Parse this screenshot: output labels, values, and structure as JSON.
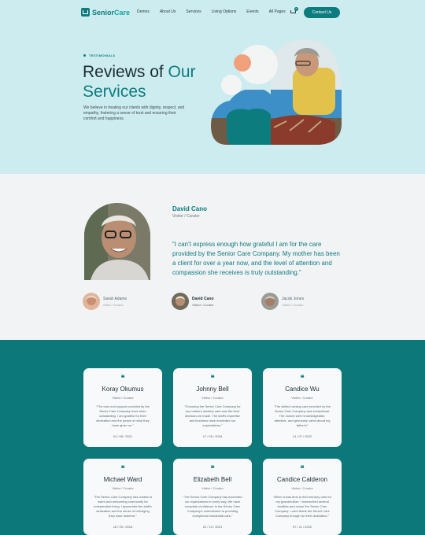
{
  "brand": {
    "name_part1": "Senior",
    "name_part2": "Care"
  },
  "nav": {
    "items": [
      "Demos",
      "About Us",
      "Services",
      "Living Options",
      "Events",
      "All Pages"
    ],
    "cart_count": "0",
    "contact_label": "Contact Us"
  },
  "hero": {
    "eyebrow": "TESTIMONIALS",
    "title_line1": "Reviews of ",
    "title_accent1": "Our",
    "title_accent2": "Services",
    "description": "We believe in treating our clients with dignity, respect, and empathy, fostering a sense of trust and ensuring their comfort and happiness."
  },
  "featured": {
    "name": "David Cano",
    "role": "Visitor / Curator",
    "quote": "“I can’t express enough how grateful I am for the care provided by the Senior Care Company. My mother has been a client for over a year now, and the level of attention and compassion she receives is truly outstanding.”",
    "people": [
      {
        "name": "Sarah Adams",
        "role": "Artist / Curator"
      },
      {
        "name": "David Cano",
        "role": "Visitor / Curator"
      },
      {
        "name": "Jacob Jones",
        "role": "Visitor / Curator"
      }
    ]
  },
  "cards": [
    {
      "name": "Koray Okumus",
      "role": "Visitor / Curator",
      "text": "“The care and support provided by the Senior Care Company have been outstanding. I am grateful for their dedication and the peace of mind they have given us.”",
      "date": "04 / 08 / 2021"
    },
    {
      "name": "Johnny Bell",
      "role": "Visitor / Curator",
      "text": "“Choosing the Senior Care Company for my mothers ministry care was the best decision we made. The staff's expertise and kindness have exceeded our expectations.”",
      "date": "17 / 05 / 2018"
    },
    {
      "name": "Candice Wu",
      "role": "Visitor / Curator",
      "text": "“The skilled nursing care provided by the Senior Care Company was exceptional. The nurses were knowledgeable, attentive, and genuinely cared about my father's”",
      "date": "14 / 07 / 2022"
    },
    {
      "name": "Michael Ward",
      "role": "Visitor / Curator",
      "text": "“The Senior Care Company has created a warm and welcoming community for independent living. I appreciate the staff's dedication and the sense of belonging they have fostered.”",
      "date": "18 / 09 / 2016"
    },
    {
      "name": "Elizabeth Bell",
      "role": "Visitor / Curator",
      "text": "“The Senior Care Company has exceeded our expectations in every way. We have complete confidence in the Senior Care Company's commitment to providing exceptional residential care.”",
      "date": "22 / 10 / 2021"
    },
    {
      "name": "Candice Calderon",
      "role": "Visitor / Curator",
      "text": "“When it was time to find memory care for my grandmother, I researched several facilities and chose the Senior Care Company. I can't thank the Senior Care Company enough for their dedication.”",
      "date": "07 / 11 / 2022"
    }
  ],
  "colors": {
    "primary": "#0d7c7f",
    "hero_bg": "#cdecef",
    "section_bg": "#0d787a"
  }
}
